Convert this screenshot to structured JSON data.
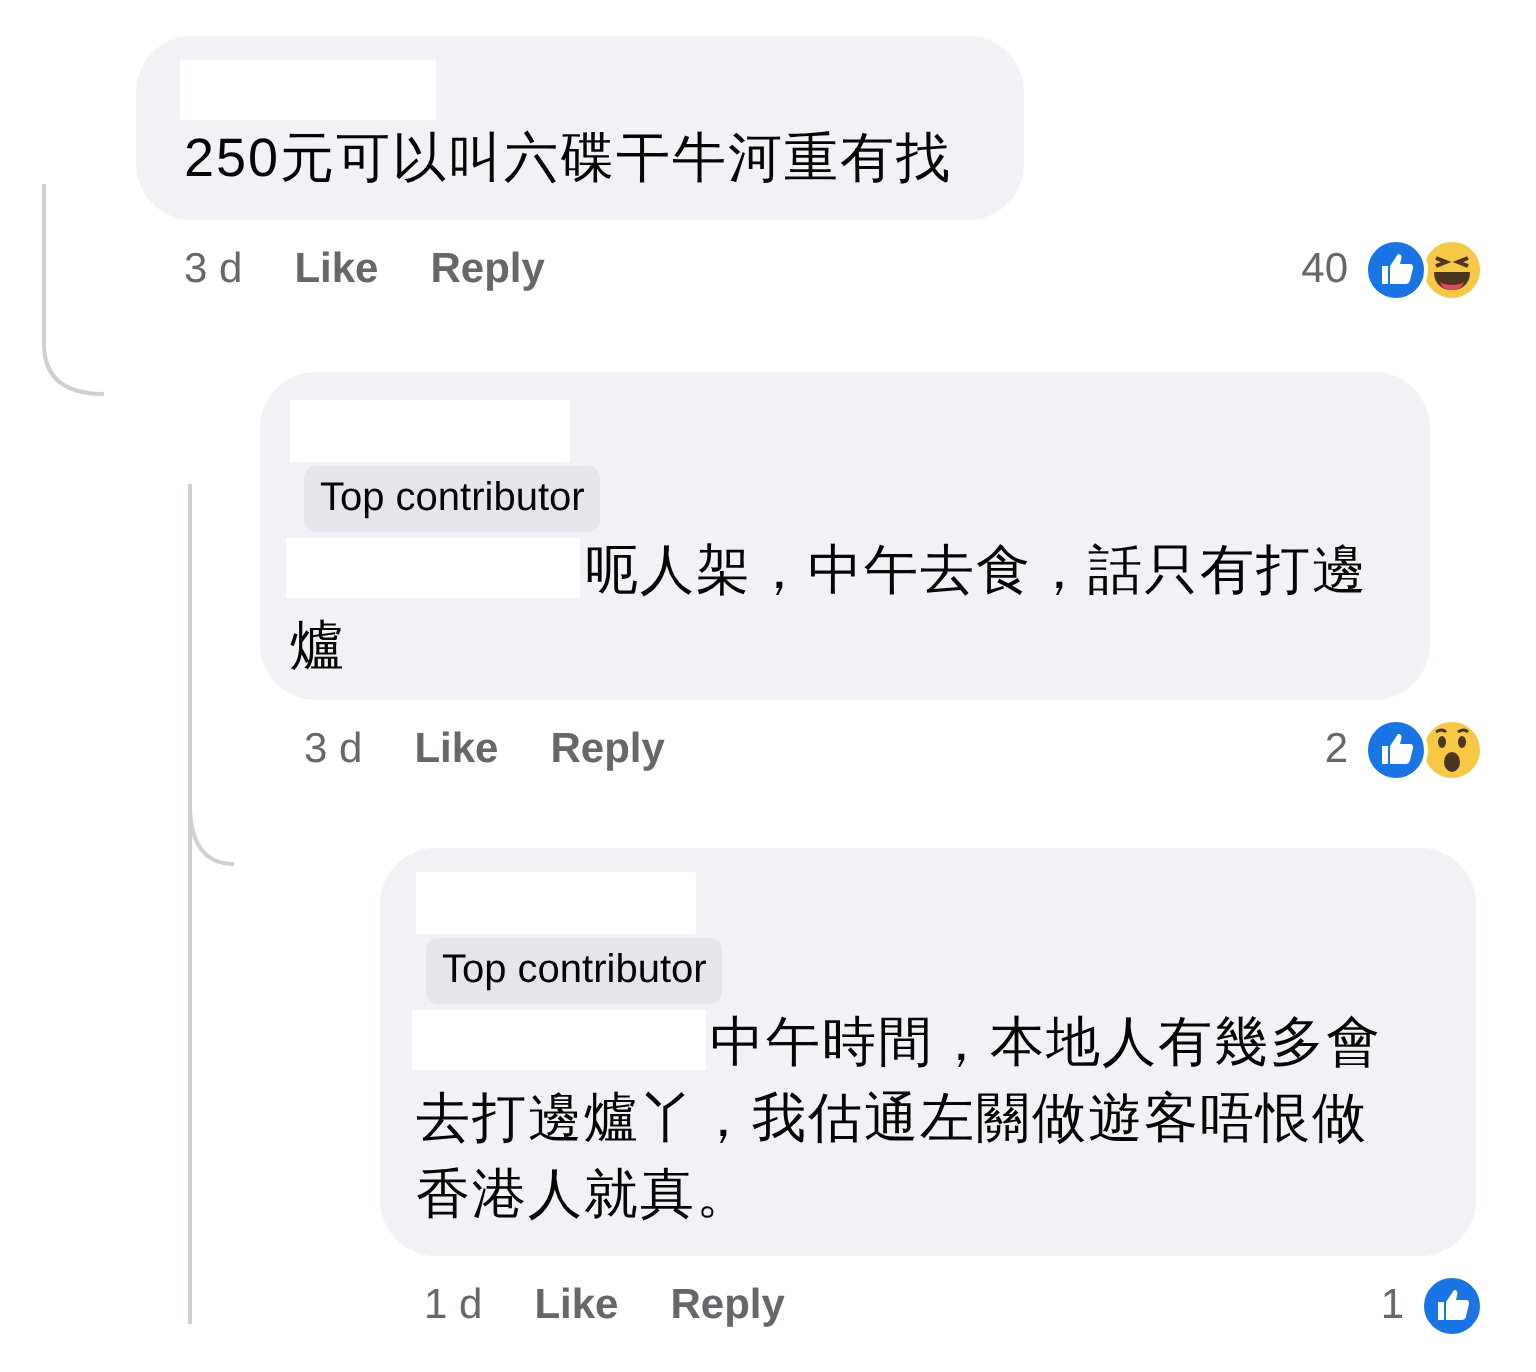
{
  "comments": [
    {
      "text_prefix_redacted": false,
      "text": "250元可以叫六碟干牛河重有找",
      "time": "3 d",
      "like_label": "Like",
      "reply_label": "Reply",
      "reaction_count": "40",
      "reactions": [
        {
          "kind": "like"
        },
        {
          "kind": "haha"
        }
      ],
      "replies": [
        {
          "text_prefix_redacted": true,
          "badge": "Top contributor",
          "text": "呃人架，中午去食，話只有打邊爐",
          "time": "3 d",
          "like_label": "Like",
          "reply_label": "Reply",
          "reaction_count": "2",
          "reactions": [
            {
              "kind": "like"
            },
            {
              "kind": "wow"
            }
          ],
          "replies": [
            {
              "text_prefix_redacted": true,
              "badge": "Top contributor",
              "text": "中午時間，本地人有幾多會去打邊爐丫，我估通左關做遊客唔恨做香港人就真。",
              "time": "1 d",
              "like_label": "Like",
              "reply_label": "Reply",
              "reaction_count": "1",
              "reactions": [
                {
                  "kind": "like"
                }
              ]
            }
          ]
        }
      ]
    }
  ]
}
